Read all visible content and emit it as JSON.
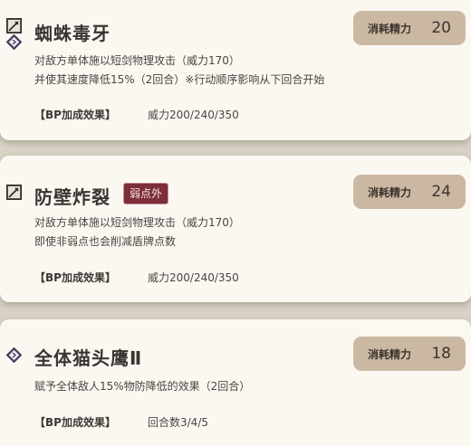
{
  "skills": [
    {
      "name": "蜘蛛毒牙",
      "cost_label": "消耗精力",
      "cost": "20",
      "desc_line1": "对敌方单体施以短剑物理攻击（威力170）",
      "desc_line2": "并使其速度降低15%（2回合）※行动顺序影响从下回合开始",
      "bp_label": "【BP加成效果】",
      "bp_value": "威力200/240/350",
      "icons": [
        "sword-icon",
        "diamond-icon"
      ]
    },
    {
      "name": "防壁炸裂",
      "badge": "弱点外",
      "cost_label": "消耗精力",
      "cost": "24",
      "desc_line1": "对敌方单体施以短剑物理攻击（威力170）",
      "desc_line2": "即使非弱点也会削减盾牌点数",
      "bp_label": "【BP加成效果】",
      "bp_value": "威力200/240/350",
      "icons": [
        "sword-icon"
      ]
    },
    {
      "name": "全体猫头鹰Ⅱ",
      "cost_label": "消耗精力",
      "cost": "18",
      "desc_line1": "赋予全体敌人15%物防降低的效果（2回合）",
      "bp_label": "【BP加成效果】",
      "bp_value": "回合数3/4/5",
      "icons": [
        "diamond-icon"
      ]
    }
  ],
  "colors": {
    "card_bg": "#fbf8f2",
    "cost_box": "#cbb8a2",
    "badge_bg": "#7d2e38",
    "text_dark": "#3a3530"
  }
}
